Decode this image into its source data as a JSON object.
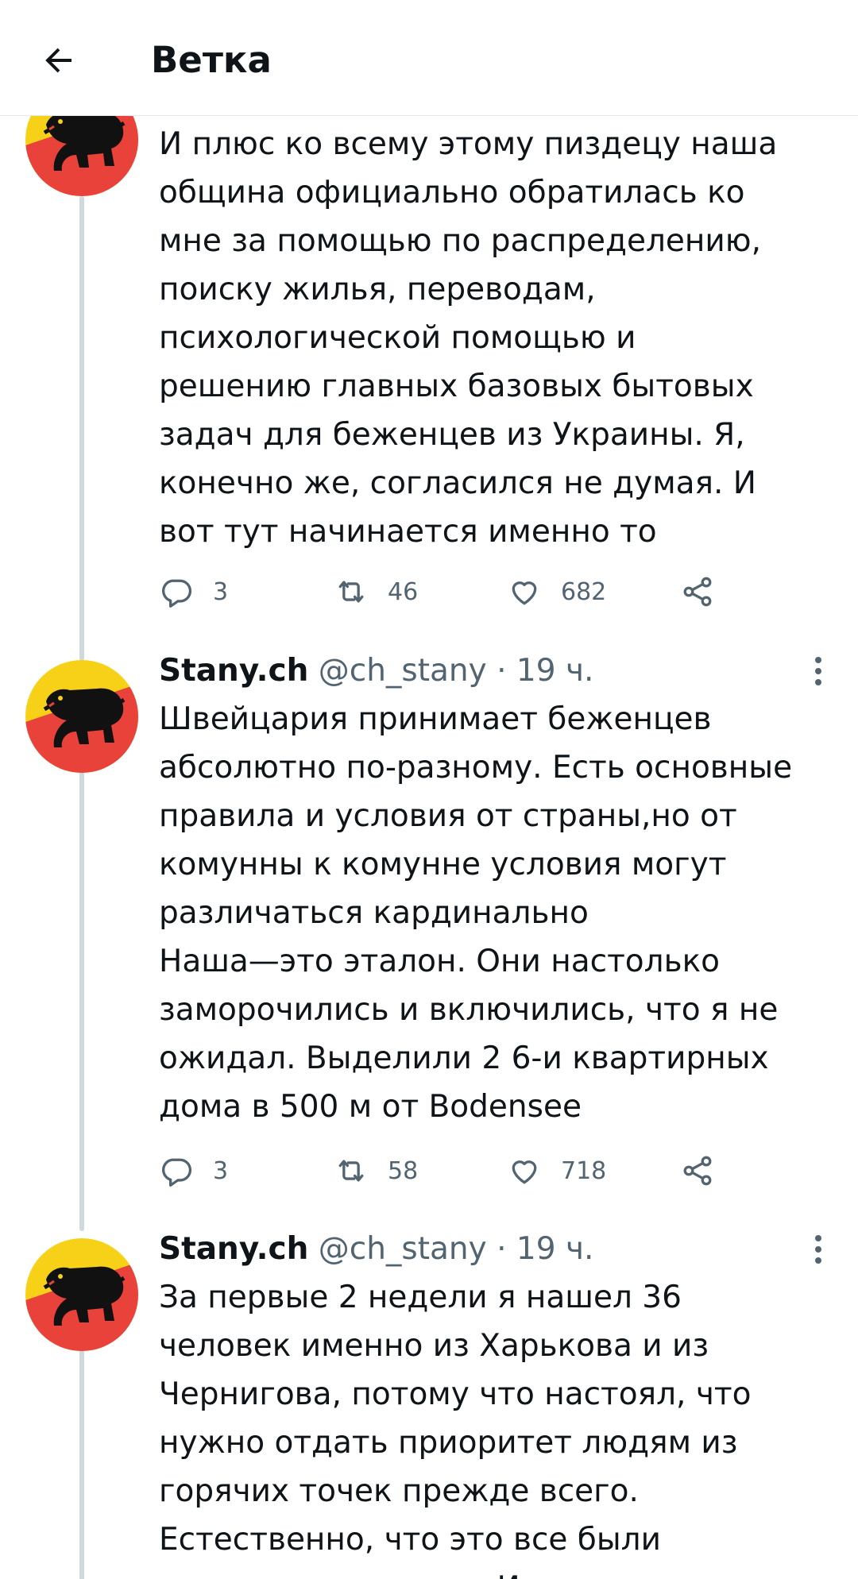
{
  "header": {
    "title": "Ветка",
    "back_icon": "arrow-left-icon"
  },
  "colors": {
    "text": "#0f1419",
    "secondary": "#536471",
    "thread_line": "#cfd9de",
    "avatar_red": "#e8423b",
    "avatar_yellow": "#f7d117",
    "avatar_black": "#111111"
  },
  "tweets": [
    {
      "text_lines": [
        "И плюс ко всему этому пиздецу наша",
        "община официально обратилась ко",
        "мне за помощью по распределению,",
        "поиску жилья, переводам,",
        "психологической помощью и",
        "решению главных базовых бытовых",
        "задач для беженцев из Украины. Я,",
        "конечно же, согласился не думая. И",
        "вот тут начинается именно то"
      ],
      "replies": "3",
      "retweets": "46",
      "likes": "682"
    },
    {
      "name": "Stany.ch",
      "meta": "@ch_stany · 19 ч.",
      "text_lines": [
        "Швейцария принимает беженцев",
        "абсолютно по-разному. Есть основные",
        "правила и условия от страны,но от",
        "комунны к комунне условия могут",
        "различаться кардинально",
        "Наша—это эталон. Они настолько",
        "заморочились и включились, что я не",
        "ожидал. Выделили 2 6-и квартирных",
        "дома в 500 м от Bodensee"
      ],
      "replies": "3",
      "retweets": "58",
      "likes": "718"
    },
    {
      "name": "Stany.ch",
      "meta": "@ch_stany · 19 ч.",
      "text_lines": [
        "За первые 2 недели я нашел 36",
        "человек именно из Харькова и из",
        "Чернигова, потому что настоял, что",
        "нужно отдать приоритет людям из",
        "горячих точек прежде всего.",
        "Естественно, что это все были",
        "женщины с детьми. И."
      ]
    }
  ],
  "icons": {
    "reply": "reply-icon",
    "retweet": "retweet-icon",
    "like": "heart-icon",
    "share": "share-icon",
    "more": "more-vertical-icon"
  }
}
